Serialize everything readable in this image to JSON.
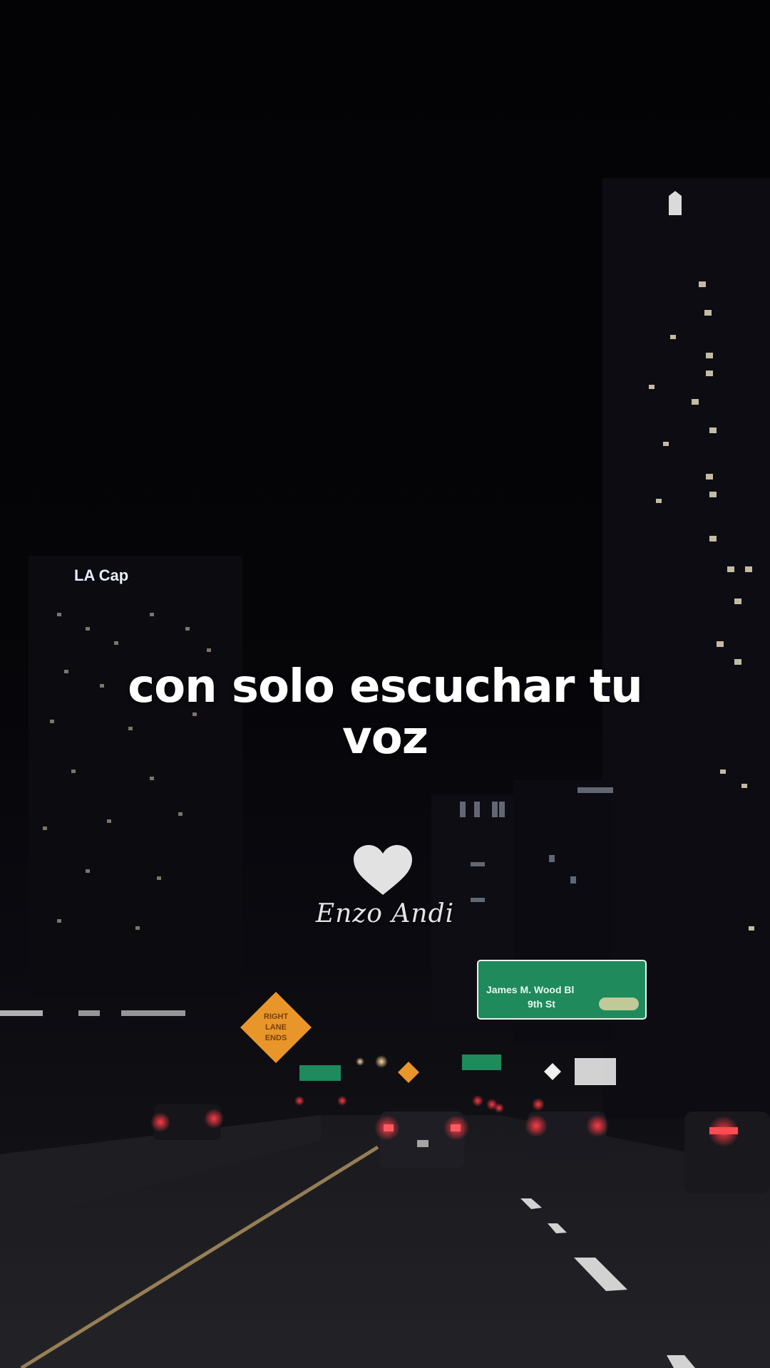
{
  "caption": {
    "line1": "con solo escuchar tu",
    "line2": "voz"
  },
  "watermark": {
    "icon": "heart-icon",
    "icon_color": "#e2e2e2",
    "signature": "Enzo Andi"
  },
  "background": {
    "scene": "night-highway-city",
    "building_sign": "LA Cap",
    "highway_sign_lines": [
      "James M. Wood Bl",
      "9th St"
    ],
    "warning_sign_lines": [
      "RIGHT",
      "LANE",
      "ENDS"
    ],
    "colors": {
      "sky": "#030305",
      "road": "#1b1b1f",
      "window_light": "#f2e7c8",
      "sign_green": "#1f8a5c",
      "sign_orange": "#e8962a",
      "tail_light": "#ff2a35"
    }
  }
}
